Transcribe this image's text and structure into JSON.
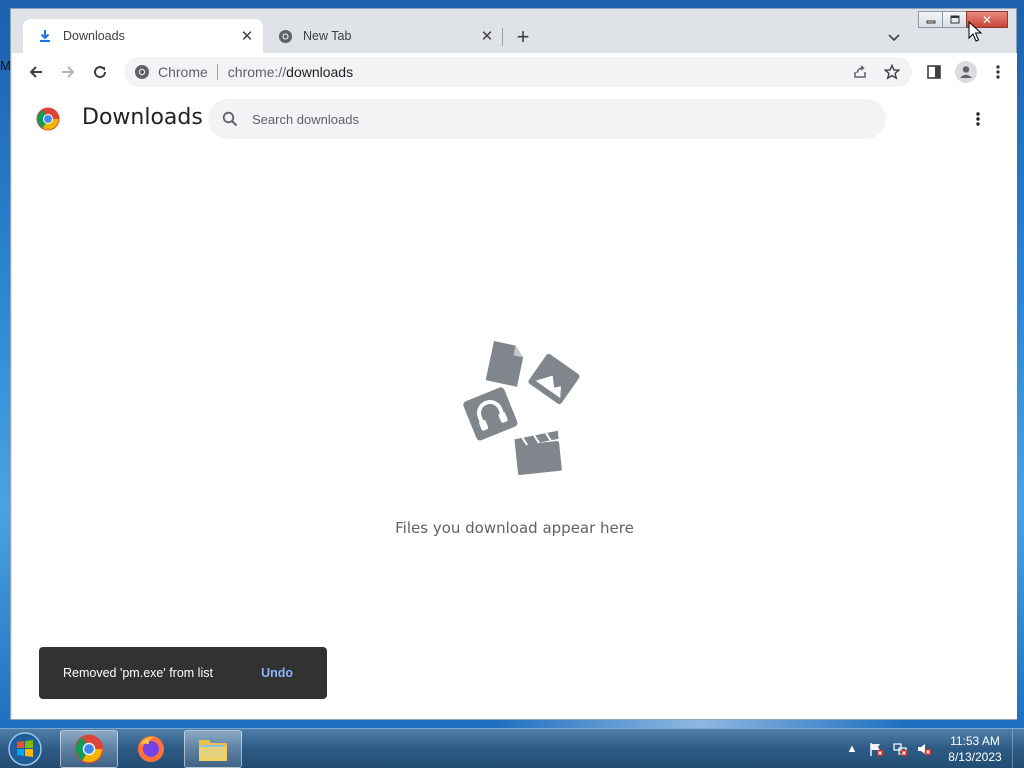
{
  "desktop": {
    "edge_letter": "M"
  },
  "window": {
    "controls": {
      "minimize": "minimize",
      "maximize": "maximize",
      "close": "close"
    }
  },
  "tabs": [
    {
      "title": "Downloads",
      "icon": "download-icon",
      "active": true
    },
    {
      "title": "New Tab",
      "icon": "chrome-icon",
      "active": false
    }
  ],
  "toolbar": {
    "chip_label": "Chrome",
    "url_scheme": "chrome://",
    "url_host": "downloads"
  },
  "page": {
    "title": "Downloads",
    "search_placeholder": "Search downloads",
    "empty_message": "Files you download appear here"
  },
  "toast": {
    "message": "Removed 'pm.exe' from list",
    "action": "Undo"
  },
  "taskbar": {
    "items": [
      "chrome",
      "firefox",
      "file-explorer"
    ],
    "clock_time": "11:53 AM",
    "clock_date": "8/13/2023"
  },
  "colors": {
    "accent": "#1a73e8",
    "toast_bg": "#323232",
    "toast_action": "#8ab4f8",
    "empty_art": "#80868b"
  }
}
